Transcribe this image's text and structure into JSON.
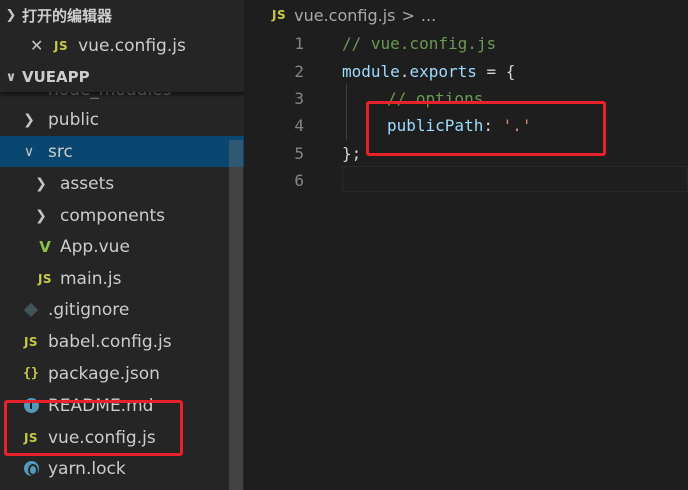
{
  "sidebar": {
    "open_editors": {
      "title": "打开的编辑器",
      "items": [
        {
          "label": "vue.config.js",
          "icon": "JS"
        }
      ]
    },
    "project": {
      "title": "VUEAPP",
      "tree": [
        {
          "label": "node_modules",
          "type": "folder",
          "partial": true
        },
        {
          "label": "public",
          "type": "folder"
        },
        {
          "label": "src",
          "type": "folder",
          "expanded": true,
          "selected": true
        },
        {
          "label": "assets",
          "type": "folder"
        },
        {
          "label": "components",
          "type": "folder"
        },
        {
          "label": "App.vue",
          "icon": "V"
        },
        {
          "label": "main.js",
          "icon": "JS"
        },
        {
          "label": ".gitignore"
        },
        {
          "label": "babel.config.js",
          "icon": "JS"
        },
        {
          "label": "package.json",
          "icon": "{}"
        },
        {
          "label": "README.md",
          "icon": "i"
        },
        {
          "label": "vue.config.js",
          "icon": "JS"
        },
        {
          "label": "yarn.lock"
        }
      ]
    }
  },
  "editor": {
    "breadcrumb": {
      "file": "vue.config.js",
      "sep": ">",
      "more": "..."
    },
    "lines": [
      {
        "n": "1",
        "text": "// vue.config.js"
      },
      {
        "n": "2",
        "a": "module",
        "b": ".",
        "c": "exports",
        "d": " = {"
      },
      {
        "n": "3",
        "text": "// options"
      },
      {
        "n": "4",
        "key": "publicPath",
        "colon": ": ",
        "val": "'.'"
      },
      {
        "n": "5",
        "text": "};"
      },
      {
        "n": "6",
        "text": ""
      }
    ]
  },
  "colors": {
    "sidebar_bg": "#252526",
    "editor_bg": "#1e1e1e",
    "selection": "#094771",
    "highlight": "#e8212a",
    "js_icon": "#cbcb41",
    "vue_icon": "#8dc149"
  }
}
